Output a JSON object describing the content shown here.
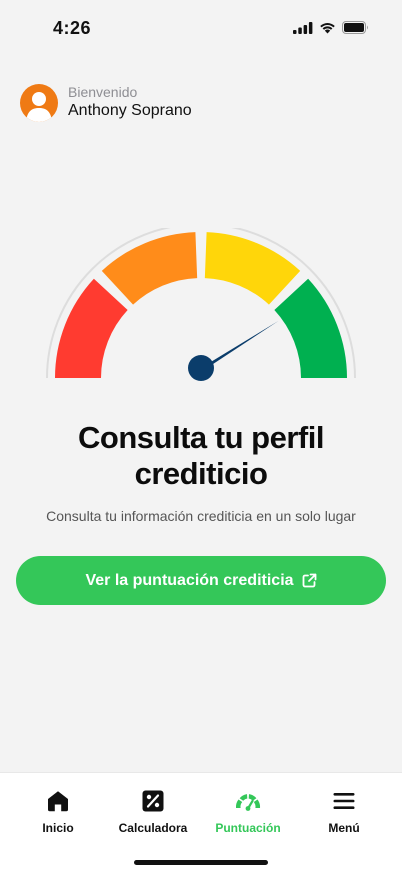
{
  "status_bar": {
    "time": "4:26"
  },
  "user": {
    "greeting": "Bienvenido",
    "name": "Anthony Soprano"
  },
  "gauge": {
    "segments": [
      "#ff3b30",
      "#ff8c1a",
      "#ffd60a",
      "#00b050"
    ],
    "needle_color": "#0b3d6b",
    "level": 0.82
  },
  "main": {
    "title_line1": "Consulta tu perfil",
    "title_line2": "crediticio",
    "subtitle": "Consulta tu información crediticia en un solo lugar",
    "cta_label": "Ver la puntuación crediticia",
    "accent": "#34c759"
  },
  "tabs": [
    {
      "label": "Inicio",
      "icon": "home-icon"
    },
    {
      "label": "Calculadora",
      "icon": "percent-icon"
    },
    {
      "label": "Puntuación",
      "icon": "gauge-icon",
      "active": true
    },
    {
      "label": "Menú",
      "icon": "menu-icon"
    }
  ]
}
